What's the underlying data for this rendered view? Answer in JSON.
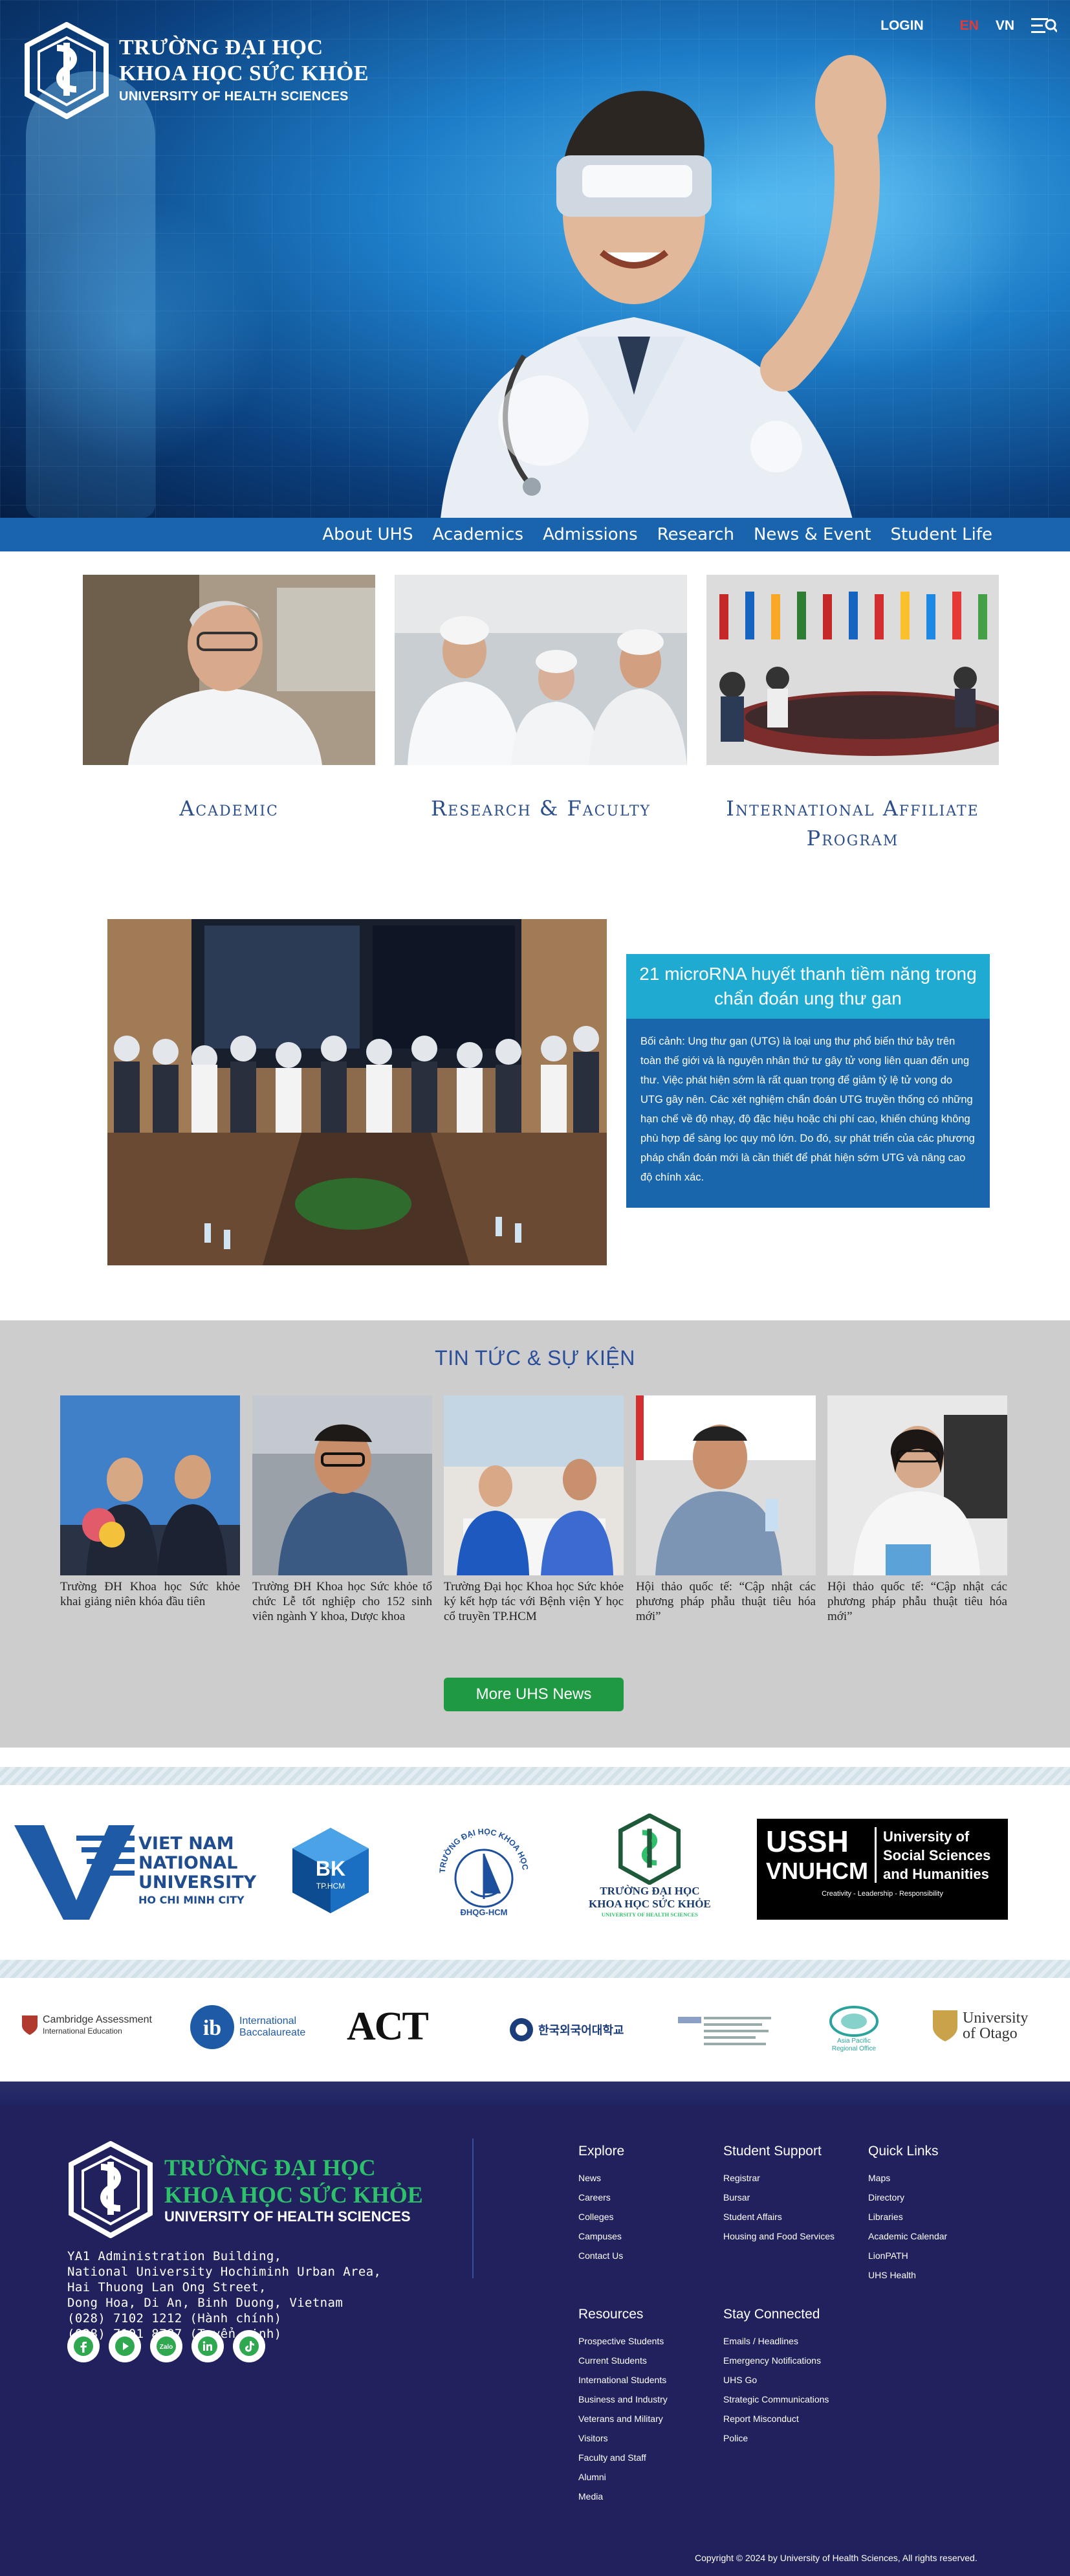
{
  "header": {
    "logo": {
      "line1": "TRƯỜNG ĐẠI HỌC",
      "line2": "KHOA HỌC SỨC KHỎE",
      "line3": "UNIVERSITY OF HEALTH SCIENCES"
    },
    "login": "LOGIN",
    "lang_en": "EN",
    "lang_vn": "VN",
    "menu_icon": "search-menu-icon"
  },
  "nav": [
    "About UHS",
    "Academics",
    "Admissions",
    "Research",
    "News & Event",
    "Student Life"
  ],
  "programs": [
    {
      "label": "Academic"
    },
    {
      "label": "Research & Faculty"
    },
    {
      "label": "International Affiliate Program"
    }
  ],
  "feature": {
    "title": "21 microRNA huyết thanh tiềm năng trong chẩn đoán ung thư gan",
    "body": "Bối cảnh: Ung thư gan (UTG) là loại ung thư phổ biến thứ bảy trên toàn thế giới và là nguyên nhân thứ tư gây tử vong liên quan đến ung thư. Việc phát hiện sớm là rất quan trọng để giảm tỷ lệ tử vong do UTG gây nên. Các xét nghiệm chẩn đoán UTG truyền thống có những hạn chế về độ nhạy, độ đặc hiệu hoặc chi phí cao, khiến chúng không phù hợp để sàng lọc quy mô lớn. Do đó, sự phát triển của các phương pháp chẩn đoán mới là cần thiết để phát hiện sớm UTG và nâng cao độ chính xác."
  },
  "news": {
    "title": "TIN TỨC & SỰ KIỆN",
    "items": [
      {
        "caption": "Trường ĐH Khoa học Sức khỏe khai giảng niên khóa đầu tiên"
      },
      {
        "caption": "Trường ĐH Khoa học Sức khỏe tổ chức Lễ tốt nghiệp cho 152 sinh viên ngành Y khoa, Dược khoa"
      },
      {
        "caption": "Trường Đại học Khoa học Sức khỏe ký kết hợp tác với Bệnh viện Y học cổ truyền TP.HCM"
      },
      {
        "caption": "Hội thảo quốc tế: “Cập nhật các phương pháp phẫu thuật tiêu hóa mới”"
      },
      {
        "caption": "Hội thảo quốc tế: “Cập nhật các phương pháp phẫu thuật tiêu hóa mới”"
      }
    ],
    "more_button": "More UHS News"
  },
  "partners": {
    "vnu": {
      "l1": "VIET NAM",
      "l2": "NATIONAL",
      "l3": "UNIVERSITY",
      "l4": "HO CHI MINH CITY"
    },
    "bk": {
      "l1": "BK",
      "l2": "TP.HCM"
    },
    "hcmus": {
      "text": "TRƯỜNG ĐẠI HỌC KHOA HỌC TỰ NHIÊN",
      "sub": "ĐHQG-HCM"
    },
    "uhs": {
      "l1": "TRƯỜNG ĐẠI HỌC",
      "l2": "KHOA HỌC SỨC KHỎE",
      "l3": "UNIVERSITY OF HEALTH SCIENCES"
    },
    "ussh": {
      "big": "USSH",
      "big2": "VNUHCM",
      "l1": "University of",
      "l2": "Social Sciences",
      "l3": "and Humanities",
      "tag": "Creativity - Leadership - Responsibility"
    }
  },
  "partners2": {
    "cambridge": {
      "l1": "Cambridge Assessment",
      "l2": "International Education"
    },
    "ib": {
      "l1": "International",
      "l2": "Baccalaureate"
    },
    "act": "ACT",
    "korea": "한국외국어대학교",
    "asia": {
      "l1": "Asia Pacific",
      "l2": "Regional Office"
    },
    "otago": {
      "l1": "University",
      "l2": "of Otago"
    }
  },
  "footer": {
    "logo": {
      "line1": "TRƯỜNG ĐẠI HỌC",
      "line2": "KHOA HỌC SỨC KHỎE",
      "line3": "UNIVERSITY OF HEALTH SCIENCES"
    },
    "address": [
      "YA1 Administration Building,",
      "National University Hochiminh Urban Area,",
      "Hai Thuong Lan Ong Street,",
      "Dong Hoa, Di An, Binh Duong, Vietnam",
      "(028) 7102 1212 (Hành chính)",
      "(028) 7101 8787 (Tuyển sinh)"
    ],
    "socials": [
      "facebook-icon",
      "youtube-icon",
      "zalo-icon",
      "linkedin-icon",
      "tiktok-icon"
    ],
    "explore": {
      "title": "Explore",
      "items": [
        "News",
        "Careers",
        "Colleges",
        "Campuses",
        "Contact Us"
      ]
    },
    "student_support": {
      "title": "Student Support",
      "items": [
        "Registrar",
        "Bursar",
        "Student Affairs",
        "Housing and Food Services"
      ]
    },
    "quick_links": {
      "title": "Quick Links",
      "items": [
        "Maps",
        "Directory",
        "Libraries",
        "Academic Calendar",
        "LionPATH",
        "UHS Health"
      ]
    },
    "resources": {
      "title": "Resources",
      "items": [
        "Prospective Students",
        "Current Students",
        "International Students",
        "Business and Industry",
        "Veterans and Military",
        "Visitors",
        "Faculty and Staff",
        "Alumni",
        "Media"
      ]
    },
    "stay_connected": {
      "title": "Stay Connected",
      "items": [
        "Emails / Headlines",
        "Emergency Notifications",
        "UHS Go",
        "Strategic Communications",
        "Report Misconduct",
        "Police"
      ]
    },
    "copyright": "Copyright © 2024 by University of Health Sciences, All rights reserved."
  }
}
